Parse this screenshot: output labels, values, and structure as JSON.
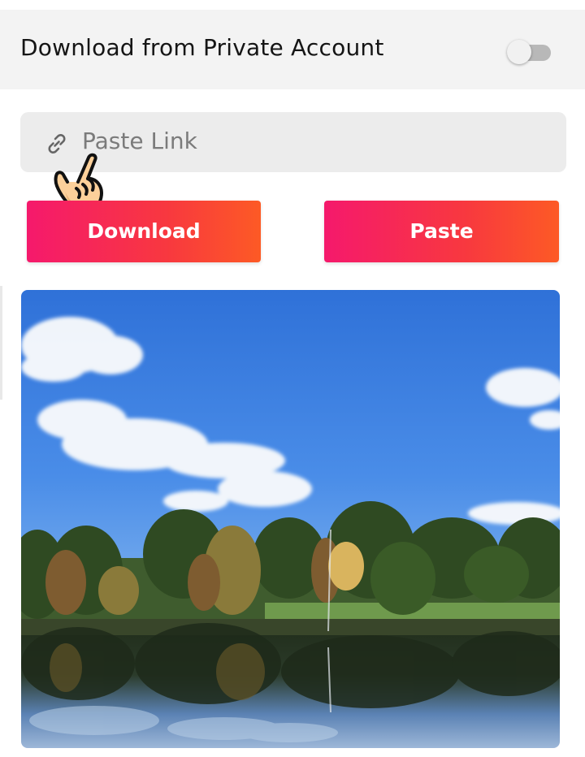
{
  "private_download": {
    "label": "Download from Private Account",
    "toggle_state": "off"
  },
  "link_input": {
    "value": "",
    "placeholder": "Paste Link"
  },
  "icons": {
    "link": "link-icon",
    "pointer": "pointing-hand-icon"
  },
  "buttons": {
    "download_label": "Download",
    "paste_label": "Paste"
  },
  "colors": {
    "button_gradient_start": "#f5196c",
    "button_gradient_end": "#fd5a25",
    "panel_background": "#f3f3f3",
    "input_background": "#ececec"
  }
}
